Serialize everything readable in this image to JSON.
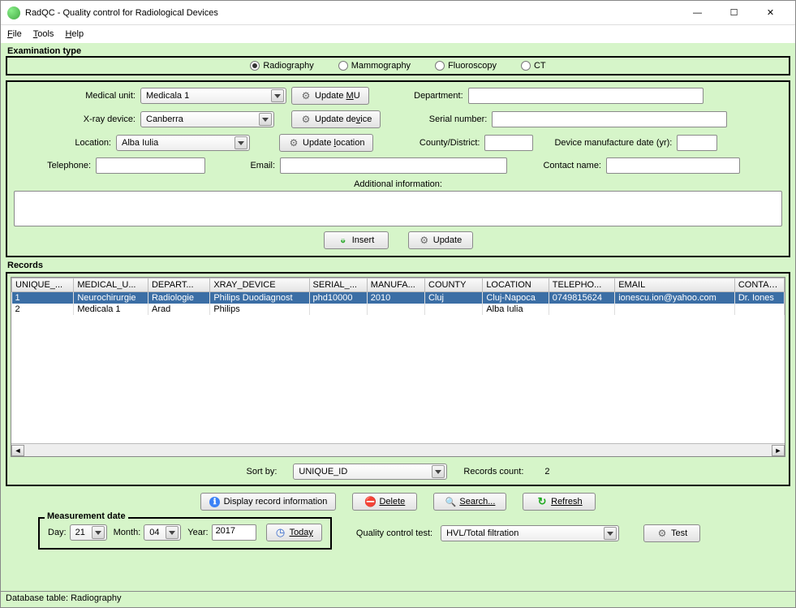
{
  "window": {
    "title": "RadQC - Quality control for Radiological Devices"
  },
  "menu": {
    "file": "File",
    "tools": "Tools",
    "help": "Help"
  },
  "exam_type": {
    "title": "Examination type",
    "options": {
      "radiography": "Radiography",
      "mammography": "Mammography",
      "fluoroscopy": "Fluoroscopy",
      "ct": "CT"
    },
    "selected": "radiography"
  },
  "form": {
    "medical_unit_label": "Medical unit:",
    "medical_unit_value": "Medicala 1",
    "update_mu": "Update MU",
    "xray_label": "X-ray device:",
    "xray_value": "Canberra",
    "update_device": "Update device",
    "location_label": "Location:",
    "location_value": "Alba Iulia",
    "update_location": "Update location",
    "department_label": "Department:",
    "department_value": "",
    "serial_label": "Serial number:",
    "serial_value": "",
    "county_label": "County/District:",
    "county_value": "",
    "mfg_label": "Device manufacture date (yr):",
    "mfg_value": "",
    "tel_label": "Telephone:",
    "tel_value": "",
    "email_label": "Email:",
    "email_value": "",
    "contact_label": "Contact name:",
    "contact_value": "",
    "additional_label": "Additional information:",
    "insert": "Insert",
    "update": "Update"
  },
  "records": {
    "title": "Records",
    "columns": [
      "UNIQUE_...",
      "MEDICAL_U...",
      "DEPART...",
      "XRAY_DEVICE",
      "SERIAL_...",
      "MANUFA...",
      "COUNTY",
      "LOCATION",
      "TELEPHO...",
      "EMAIL",
      "CONTAC..."
    ],
    "rows": [
      {
        "selected": true,
        "cells": [
          "1",
          "Neurochirurgie",
          "Radiologie",
          "Philips Duodiagnost",
          "phd10000",
          "2010",
          "Cluj",
          "Cluj-Napoca",
          "0749815624",
          "ionescu.ion@yahoo.com",
          "Dr. Iones"
        ]
      },
      {
        "selected": false,
        "cells": [
          "2",
          "Medicala 1",
          "Arad",
          "Philips",
          "",
          "",
          "",
          "Alba Iulia",
          "",
          "",
          ""
        ]
      }
    ],
    "sort_by_label": "Sort by:",
    "sort_by_value": "UNIQUE_ID",
    "count_label": "Records count:",
    "count_value": "2"
  },
  "actions": {
    "display": "Display record information",
    "delete": "Delete",
    "search": "Search...",
    "refresh": "Refresh"
  },
  "mdate": {
    "title": "Measurement date",
    "day_label": "Day:",
    "day_value": "21",
    "month_label": "Month:",
    "month_value": "04",
    "year_label": "Year:",
    "year_value": "2017",
    "today": "Today"
  },
  "qc": {
    "label": "Quality control test:",
    "value": "HVL/Total filtration",
    "test_btn": "Test"
  },
  "status": "Database table: Radiography"
}
